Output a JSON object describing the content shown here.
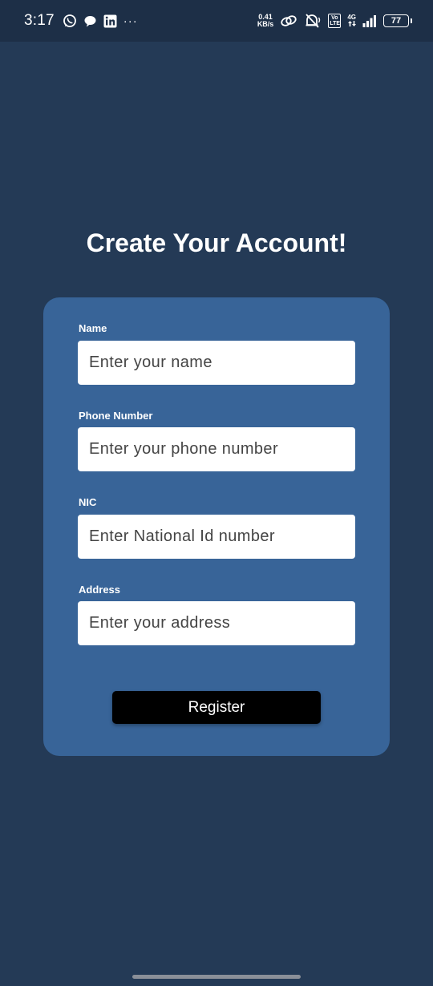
{
  "status_bar": {
    "time": "3:17",
    "more": "···",
    "net_speed_value": "0.41",
    "net_speed_unit": "KB/s",
    "volte": "Vo LTE",
    "network": "4G",
    "battery": "77",
    "icons": [
      "whatsapp-icon",
      "chat-icon",
      "linkedin-icon",
      "link-icon",
      "mute-icon",
      "signal-icon"
    ]
  },
  "page": {
    "title": "Create Your Account!"
  },
  "form": {
    "name_label": "Name",
    "name_placeholder": "Enter your name",
    "phone_label": "Phone Number",
    "phone_placeholder": "Enter your phone number",
    "nic_label": "NIC",
    "nic_placeholder": "Enter National Id number",
    "address_label": "Address",
    "address_placeholder": "Enter your address",
    "register_label": "Register"
  },
  "colors": {
    "background": "#243a56",
    "status_bar": "#1d2f47",
    "card": "#386498",
    "button": "#000000"
  }
}
